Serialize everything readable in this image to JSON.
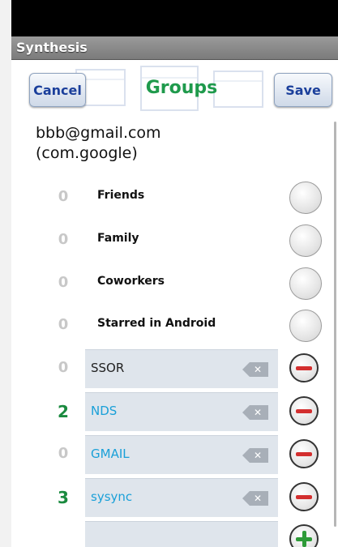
{
  "app_title": "Synthesis",
  "header": {
    "cancel_label": "Cancel",
    "title": "Groups",
    "save_label": "Save"
  },
  "account": {
    "line1": "bbb@gmail.com",
    "line2": "(com.google)"
  },
  "fixed_groups": [
    {
      "count": "0",
      "name": "Friends",
      "icon": "empty-circle-icon"
    },
    {
      "count": "0",
      "name": "Family",
      "icon": "empty-circle-icon"
    },
    {
      "count": "0",
      "name": "Coworkers",
      "icon": "empty-circle-icon"
    },
    {
      "count": "0",
      "name": "Starred in Android",
      "icon": "empty-circle-icon"
    }
  ],
  "custom_groups": [
    {
      "count": "0",
      "name": "SSOR",
      "delete_icon": "backspace-icon",
      "remove_icon": "minus-circle-icon"
    },
    {
      "count": "2",
      "name": "NDS",
      "delete_icon": "backspace-icon",
      "remove_icon": "minus-circle-icon"
    },
    {
      "count": "0",
      "name": "GMAIL",
      "delete_icon": "backspace-icon",
      "remove_icon": "minus-circle-icon"
    },
    {
      "count": "3",
      "name": "sysync",
      "delete_icon": "backspace-icon",
      "remove_icon": "minus-circle-icon"
    }
  ],
  "new_group": {
    "add_icon": "plus-circle-icon"
  },
  "colors": {
    "title_green": "#1f9a4c",
    "count_green": "#1a8a3f",
    "link_blue": "#1aa0d8",
    "minus_red": "#d32f2f",
    "plus_green": "#2e9b38"
  }
}
